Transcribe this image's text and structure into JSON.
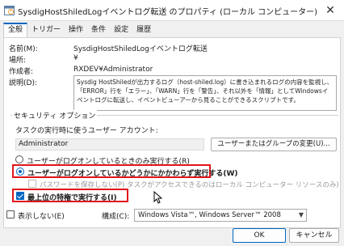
{
  "window": {
    "title": "SysdigHostShiledLogイベントログ転送 のプロパティ (ローカル コンピューター)",
    "close_glyph": "✕"
  },
  "tabs": [
    {
      "label": "全般",
      "active": true
    },
    {
      "label": "トリガー",
      "active": false
    },
    {
      "label": "操作",
      "active": false
    },
    {
      "label": "条件",
      "active": false
    },
    {
      "label": "設定",
      "active": false
    },
    {
      "label": "履歴",
      "active": false
    }
  ],
  "general": {
    "name_label": "名前(M):",
    "name_value": "SysdigHostShiledLogイベントログ転送",
    "location_label": "場所:",
    "location_value": "¥",
    "author_label": "作成者:",
    "author_value": "RXDEV¥Administrator",
    "description_label": "説明(D):",
    "description_value": "Sysdig HostShiledが出力するログ（host-shiled.log）に書き込まれるログの内容を監視し、「ERROR」行を「エラー」、「WARN」行を「警告」、それ以外を「情報」としてWindowsイベントログに転送し、イベントビューアーから見ることができるスクリプトです。"
  },
  "security": {
    "group_label": "セキュリティ オプション",
    "run_as_label": "タスクの実行時に使うユーザー アカウント:",
    "run_as_value": "Administrator",
    "change_user_button": "ユーザーまたはグループの変更(U)...",
    "radio_logged_on_only": "ユーザーがログオンしているときのみ実行する(R)",
    "radio_whether_logged_on": "ユーザーがログオンしているかどうかにかかわらず実行する(W)",
    "checkbox_no_store_password": "パスワードを保存しない(P)  タスクがアクセスできるのはローカル コンピューター リソースのみ)",
    "checkbox_highest_privileges": "最上位の特権で実行する(I)",
    "selected_radio": "whether_logged_on",
    "highest_privileges_checked": true,
    "no_store_password_checked": false
  },
  "footer": {
    "hidden_label": "表示しない(E)",
    "hidden_checked": false,
    "configure_label": "構成(C):",
    "configure_value": "Windows Vista™, Windows Server™ 2008",
    "ok_button": "OK",
    "cancel_button": "キャンセル"
  },
  "colors": {
    "accent": "#0067c0",
    "highlight_box": "#e0151b"
  },
  "icons": {
    "title": "task-scheduler-icon",
    "combo": "chevron-down-icon",
    "cursor": "mouse-pointer-icon"
  }
}
